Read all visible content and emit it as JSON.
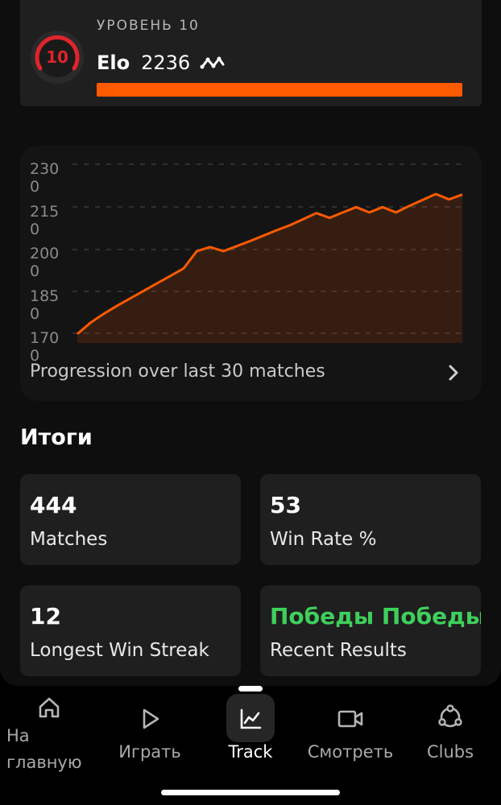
{
  "level": {
    "badge_number": "10",
    "label": "УРОВЕНЬ 10",
    "elo_word": "Elo",
    "elo_value": "2236",
    "progress": 1.0,
    "accent": "#ff5a00",
    "badge_color": "#e0242c"
  },
  "chart": {
    "caption": "Progression over last 30 matches",
    "y_ticks": [
      {
        "top": "230",
        "bottom": "0"
      },
      {
        "top": "215",
        "bottom": "0"
      },
      {
        "top": "200",
        "bottom": "0"
      },
      {
        "top": "185",
        "bottom": "0"
      },
      {
        "top": "170",
        "bottom": "0"
      }
    ]
  },
  "chart_data": {
    "type": "area",
    "x": [
      1,
      2,
      3,
      4,
      5,
      6,
      7,
      8,
      9,
      10,
      11,
      12,
      13,
      14,
      15,
      16,
      17,
      18,
      19,
      20,
      21,
      22,
      23,
      24,
      25,
      26,
      27,
      28,
      29,
      30
    ],
    "values": [
      1730,
      1768,
      1798,
      1825,
      1850,
      1875,
      1900,
      1925,
      1950,
      2008,
      2022,
      2008,
      2025,
      2042,
      2060,
      2078,
      2095,
      2115,
      2136,
      2120,
      2138,
      2156,
      2138,
      2156,
      2138,
      2160,
      2180,
      2200,
      2182,
      2198
    ],
    "ylim": [
      1700,
      2300
    ],
    "grid": true,
    "color": "#ff5a00"
  },
  "summary": {
    "title": "Итоги",
    "stats": [
      {
        "value": "444",
        "label": "Matches"
      },
      {
        "value": "53",
        "label": "Win Rate %"
      },
      {
        "value": "12",
        "label": "Longest Win Streak"
      },
      {
        "value": "Победы Победы",
        "label": "Recent Results"
      }
    ]
  },
  "nav": {
    "items": [
      {
        "label_line1": "На",
        "label_line2": "главную",
        "icon": "home-icon"
      },
      {
        "label": "Играть",
        "icon": "play-icon"
      },
      {
        "label": "Track",
        "icon": "chart-icon"
      },
      {
        "label": "Смотреть",
        "icon": "video-icon"
      },
      {
        "label": "Clubs",
        "icon": "clubs-icon"
      }
    ]
  }
}
